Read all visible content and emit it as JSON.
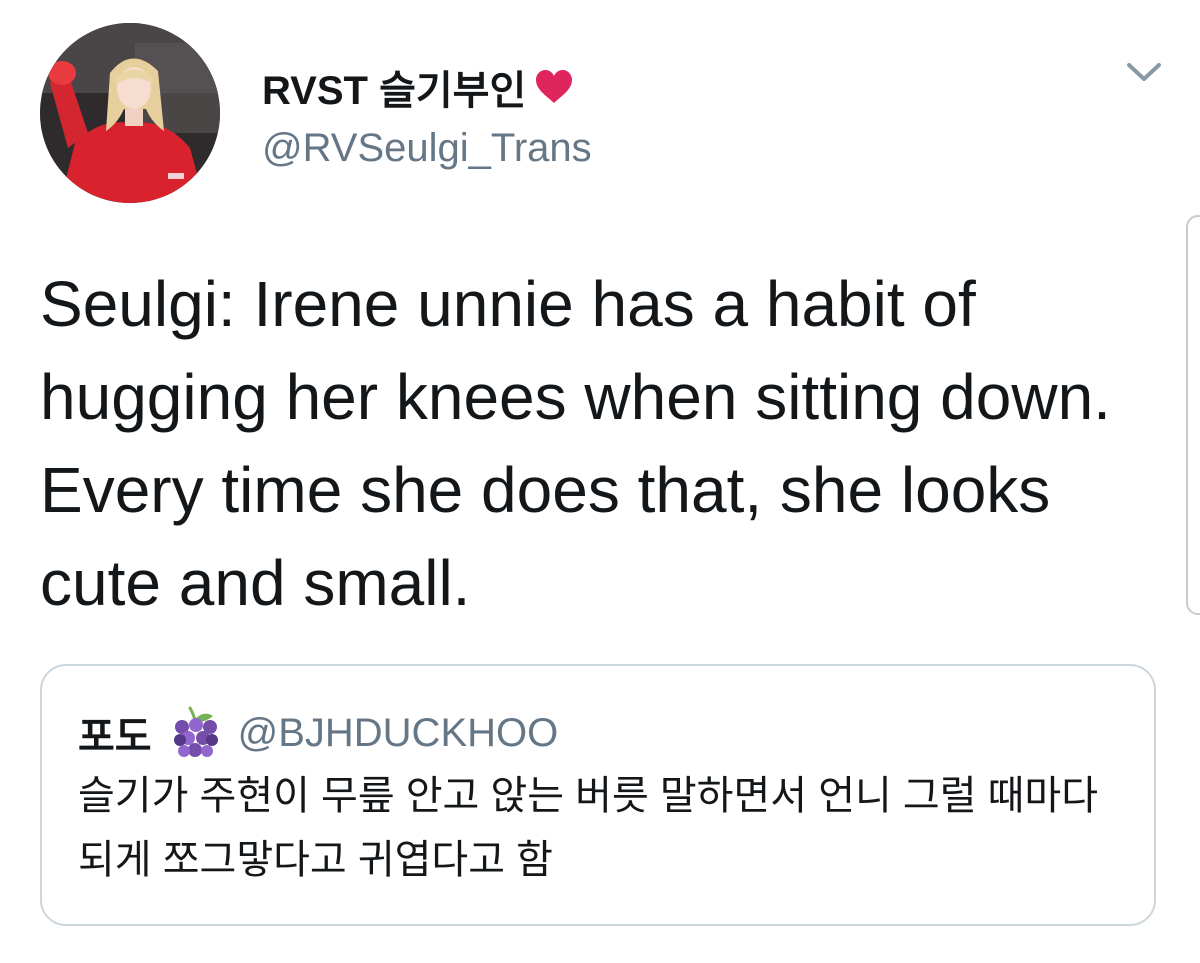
{
  "tweet": {
    "author": {
      "display_name": "RVST 슬기부인",
      "handle": "@RVSeulgi_Trans",
      "avatar_icon": "profile-photo",
      "badge_icon": "red-heart-icon"
    },
    "text": "Seulgi: Irene unnie has a habit of hugging her knees when sitting down. Every time she does that, she looks cute and small.",
    "menu_icon": "chevron-down-icon"
  },
  "quoted_tweet": {
    "display_name": "포도",
    "emoji_icon": "grapes-icon",
    "handle": "@BJHDUCKHOO",
    "text": "슬기가 주현이 무릎 안고 앉는 버릇 말하면서 언니 그럴 때마다 되게 쪼그맣다고 귀엽다고 함"
  },
  "colors": {
    "text": "#14171a",
    "secondary": "#657786",
    "border": "#ccd6dd",
    "heart": "#e0245e",
    "grapes": "#744eaa"
  }
}
